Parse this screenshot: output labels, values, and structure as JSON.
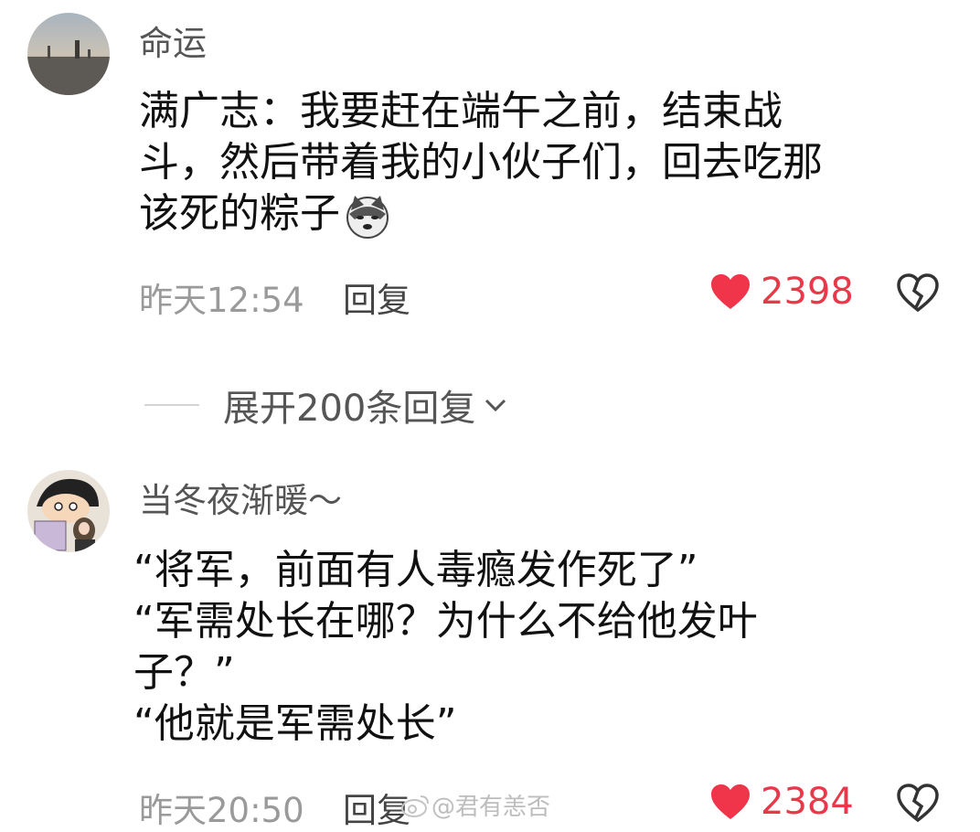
{
  "comments": [
    {
      "username": "命运",
      "lines": [
        "满广志：我要赶在端午之前，结束战",
        "斗，然后带着我的小伙子们，回去吃那",
        "该死的粽子"
      ],
      "emoji_icon": "husky-dog-emoji-icon",
      "time": "昨天12:54",
      "reply_label": "回复",
      "like_count": "2398"
    },
    {
      "username": "当冬夜渐暖～",
      "lines": [
        "“将军，前面有人毒瘾发作死了”",
        "“军需处长在哪？为什么不给他发叶",
        "子？”",
        "“他就是军需处长”"
      ],
      "time": "昨天20:50",
      "reply_label": "回复",
      "like_count": "2384"
    }
  ],
  "expand_replies_label": "展开200条回复",
  "watermark": "@君有恙否",
  "colors": {
    "like_red": "#e8394a",
    "meta_gray": "#9a9a9a"
  },
  "icons": [
    "heart-icon",
    "broken-heart-icon",
    "chevron-down-icon",
    "weibo-logo-icon"
  ]
}
